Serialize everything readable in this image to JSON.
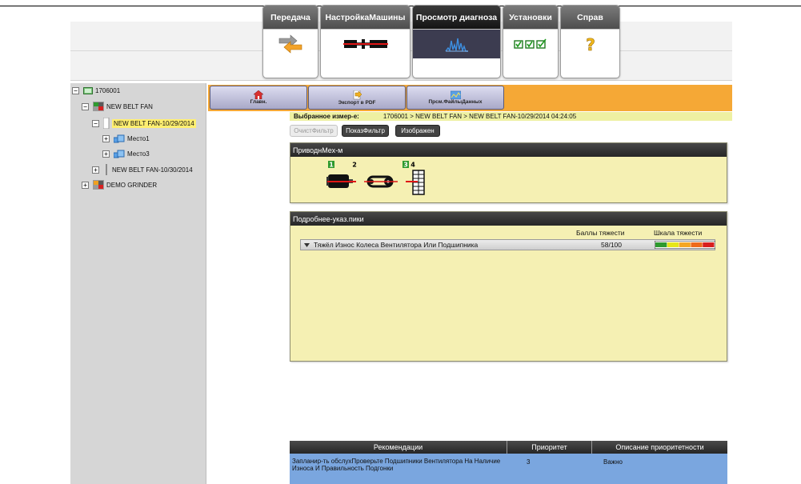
{
  "header": {
    "tabs": [
      {
        "label": "Передача",
        "icon": "transfer-arrows-icon",
        "active": false
      },
      {
        "label": "НастройкаМашины",
        "icon": "machine-setup-icon",
        "active": false
      },
      {
        "label": "Просмотр диагноза",
        "icon": "spectrum-icon",
        "active": true
      },
      {
        "label": "Установки",
        "icon": "settings-checkboxes-icon",
        "active": false
      },
      {
        "label": "Справ",
        "icon": "help-question-icon",
        "active": false
      }
    ]
  },
  "tree": {
    "root": "1706001",
    "machine1": "NEW BELT FAN",
    "session1": "NEW BELT FAN-10/29/2014",
    "location1": "Место1",
    "location3": "Место3",
    "session2": "NEW BELT FAN-10/30/2014",
    "machine2": "DEMO GRINDER",
    "expand": "+",
    "collapse": "−"
  },
  "toolbar": {
    "home": "Главн.",
    "export_pdf": "Экспорт в PDF",
    "view_data": "Прсм.ФайлыДанных"
  },
  "breadcrumb": {
    "label": "Выбранное измер-е:",
    "path": "1706001 > NEW BELT FAN > NEW BELT FAN-10/29/2014 04:24:05"
  },
  "filters": {
    "clear": "ОчистФильтр",
    "show": "ПоказФильтр",
    "image": "Изображен"
  },
  "drivetrain": {
    "title": "ПриводнМех-м",
    "components": [
      {
        "number": "1",
        "highlighted": true
      },
      {
        "number": "2",
        "highlighted": false
      },
      {
        "number": "3",
        "highlighted": true
      },
      {
        "number": "4",
        "highlighted": false
      }
    ]
  },
  "details": {
    "title": "Подробнее-указ.пики",
    "score_header": "Баллы тяжести",
    "scale_header": "Шкала тяжести",
    "fault": "Тяжёл Износ Колеса Вентилятора Или Подшипника",
    "score": "58/100",
    "severity_fraction": 0.58,
    "scale_colors": [
      "#2e9a2e",
      "#e6e61a",
      "#f5a623",
      "#ee6a1c",
      "#d81e1e"
    ]
  },
  "recommendations": {
    "headers": [
      "Рекомендации",
      "Приоритет",
      "Описание приоритетности"
    ],
    "rows": [
      {
        "text": "Запланир-ть обслухПроверьте Подшипники Вентилятора На Наличие Износа И Правильность Подгонки",
        "priority": "3",
        "description": "Важно"
      }
    ]
  }
}
